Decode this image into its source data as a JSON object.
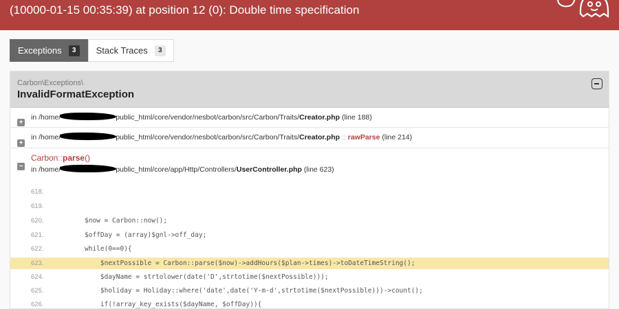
{
  "header": {
    "title": "(10000-01-15 00:35:39) at position 12 (0): Double time specification"
  },
  "tabs": [
    {
      "label": "Exceptions",
      "count": "3"
    },
    {
      "label": "Stack Traces",
      "count": "3"
    }
  ],
  "exception": {
    "namespace": "Carbon\\Exceptions\\",
    "class": "InvalidFormatException"
  },
  "traces": [
    {
      "in": "in /home/",
      "path": "public_html/core/vendor/nesbot/carbon/src/Carbon/Traits/",
      "file": "Creator.php",
      "line": "(line 188)"
    },
    {
      "in": "in /home/",
      "path": "public_html/core/vendor/nesbot/carbon/src/Carbon/Traits/",
      "file": "Creator.php",
      "sep": "::",
      "method": "rawParse",
      "line": "(line 214)"
    }
  ],
  "frame": {
    "class": "Carbon",
    "sep": "::",
    "method": "parse",
    "args": "()",
    "in": "in /home/",
    "path": "public_html/core/app/Http/Controllers/",
    "file": "UserController.php",
    "line": "(line 623)"
  },
  "code": [
    {
      "n": "618.",
      "text": ""
    },
    {
      "n": "619.",
      "text": ""
    },
    {
      "n": "620.",
      "text": "$now = Carbon::now();"
    },
    {
      "n": "621.",
      "text": "$offDay = (array)$gnl->off_day;"
    },
    {
      "n": "622.",
      "text": "while(0==0){"
    },
    {
      "n": "623.",
      "text": "    $nextPossible = Carbon::parse($now)->addHours($plan->times)->toDateTimeString();"
    },
    {
      "n": "624.",
      "text": "    $dayName = strtolower(date('D',strtotime($nextPossible)));"
    },
    {
      "n": "625.",
      "text": "    $holiday = Holiday::where('date',date('Y-m-d',strtotime($nextPossible)))->count();"
    },
    {
      "n": "626.",
      "text": "    if(!array_key_exists($dayName, $offDay)){"
    }
  ],
  "colors": {
    "header_bg": "#b0413e",
    "highlight": "#f8e8a8",
    "accent": "#b0413e"
  },
  "icons": [
    "ghost-logo-icon",
    "collapse-icon",
    "expand-icon"
  ]
}
